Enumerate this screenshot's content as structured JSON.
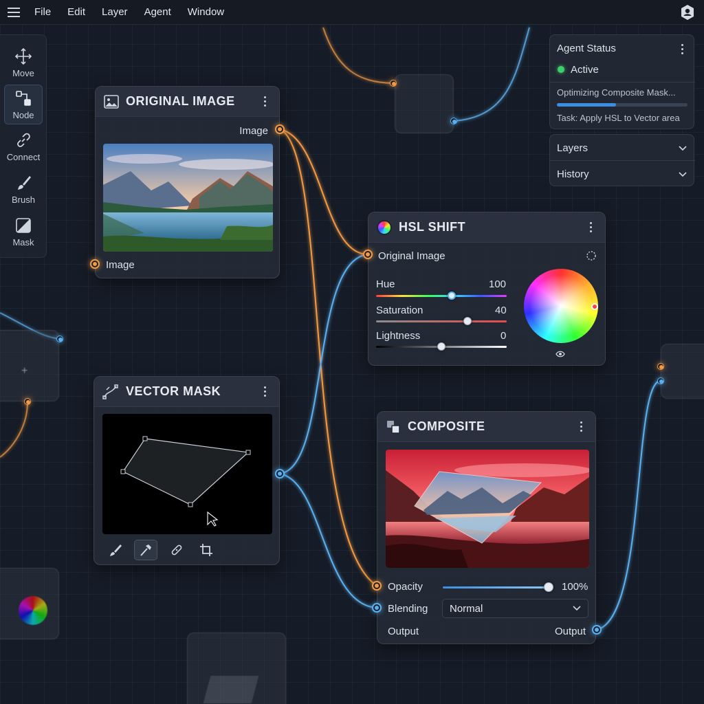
{
  "menubar": {
    "items": [
      "File",
      "Edit",
      "Layer",
      "Agent",
      "Window"
    ]
  },
  "toolbar": {
    "tools": [
      {
        "label": "Move",
        "icon": "move-icon"
      },
      {
        "label": "Node",
        "icon": "node-icon",
        "active": true
      },
      {
        "label": "Connect",
        "icon": "link-icon"
      },
      {
        "label": "Brush",
        "icon": "brush-icon"
      },
      {
        "label": "Mask",
        "icon": "mask-icon"
      }
    ]
  },
  "original_image_node": {
    "title": "ORIGINAL IMAGE",
    "output_label": "Image",
    "input_label": "Image"
  },
  "hsl_node": {
    "title": "HSL SHIFT",
    "input_label": "Original Image",
    "sliders": [
      {
        "label": "Hue",
        "value": "100",
        "level": 0.58
      },
      {
        "label": "Saturation",
        "value": "40",
        "level": 0.7
      },
      {
        "label": "Lightness",
        "value": "0",
        "level": 0.5
      }
    ]
  },
  "vector_mask_node": {
    "title": "VECTOR MASK",
    "tools": [
      "brush-icon",
      "hammer-icon",
      "bandage-icon",
      "crop-icon"
    ]
  },
  "composite_node": {
    "title": "COMPOSITE",
    "opacity_label": "Opacity",
    "opacity_value": "100%",
    "opacity_level": 1.0,
    "blending_label": "Blending",
    "blending_value": "Normal",
    "output_left_label": "Output",
    "output_right_label": "Output"
  },
  "agent_status": {
    "title": "Agent Status",
    "state": "Active",
    "state_color": "#3ecf6a",
    "progress_text": "Optimizing Composite Mask...",
    "progress_level": 0.45,
    "task_text": "Task: Apply HSL to Vector area"
  },
  "side_panels": {
    "layers_label": "Layers",
    "history_label": "History"
  },
  "colors": {
    "orange_wire": "#f39a43",
    "blue_wire": "#5bb0ef",
    "accent": "#3c8fe0"
  }
}
